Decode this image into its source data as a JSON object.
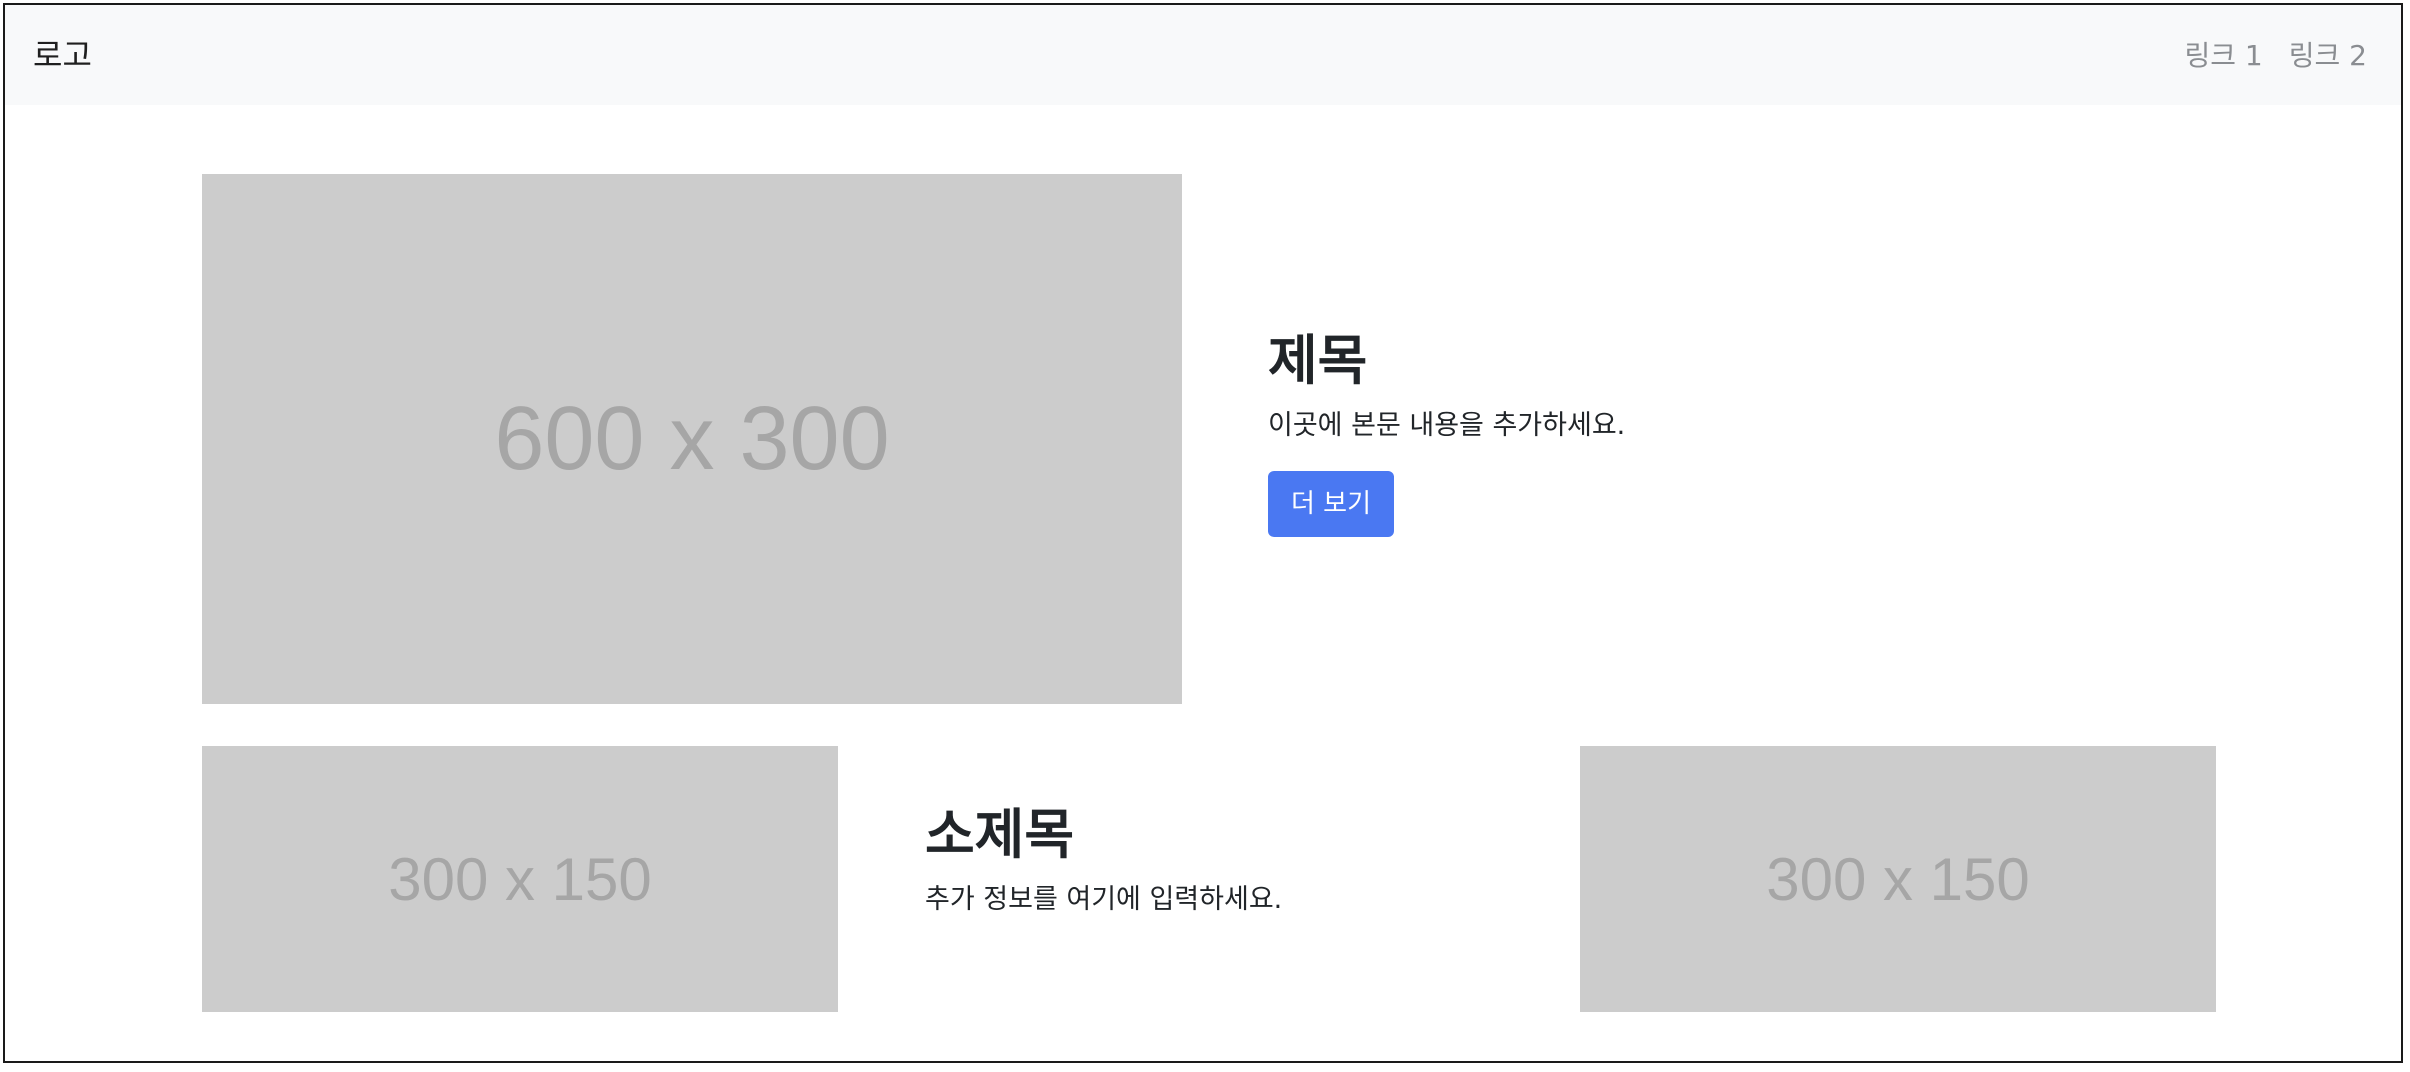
{
  "navbar": {
    "brand": "로고",
    "links": [
      "링크 1",
      "링크 2"
    ]
  },
  "hero": {
    "image_label": "600 x 300",
    "title": "제목",
    "body": "이곳에 본문 내용을 추가하세요.",
    "button_label": "더 보기",
    "button_color": "#4a78f2"
  },
  "secondary": {
    "left_image_label": "300 x 150",
    "title": "소제목",
    "body": "추가 정보를 여기에 입력하세요.",
    "right_image_label": "300 x 150"
  },
  "colors": {
    "navbar_bg": "#f8f9fa",
    "placeholder_bg": "#cccccc",
    "placeholder_text": "#a6a6a6"
  }
}
